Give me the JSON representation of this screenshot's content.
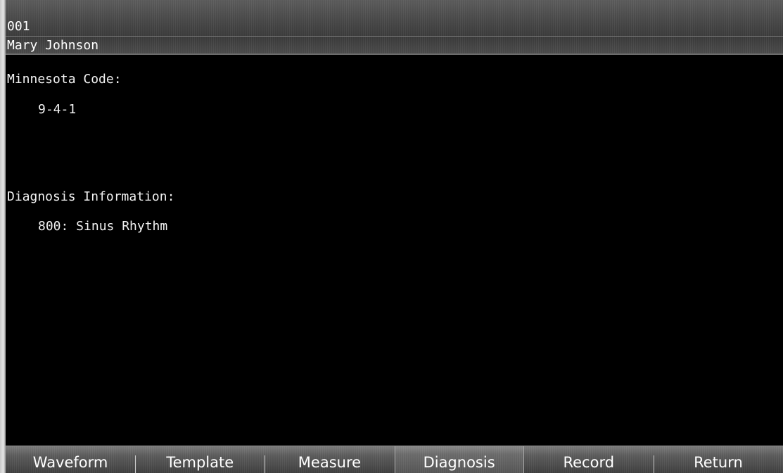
{
  "header": {
    "patient_id": "001",
    "patient_name": "Mary Johnson"
  },
  "content": {
    "minnesota_label": "Minnesota Code:",
    "minnesota_value": "9-4-1",
    "diagnosis_label": "Diagnosis Information:",
    "diagnosis_value": "800: Sinus Rhythm"
  },
  "tabs": [
    {
      "label": "Waveform"
    },
    {
      "label": "Template"
    },
    {
      "label": "Measure"
    },
    {
      "label": "Diagnosis"
    },
    {
      "label": "Record"
    },
    {
      "label": "Return"
    }
  ],
  "active_tab": "Diagnosis",
  "colors": {
    "background": "#000000",
    "text": "#ffffff",
    "bar": "#4a4a4a"
  }
}
